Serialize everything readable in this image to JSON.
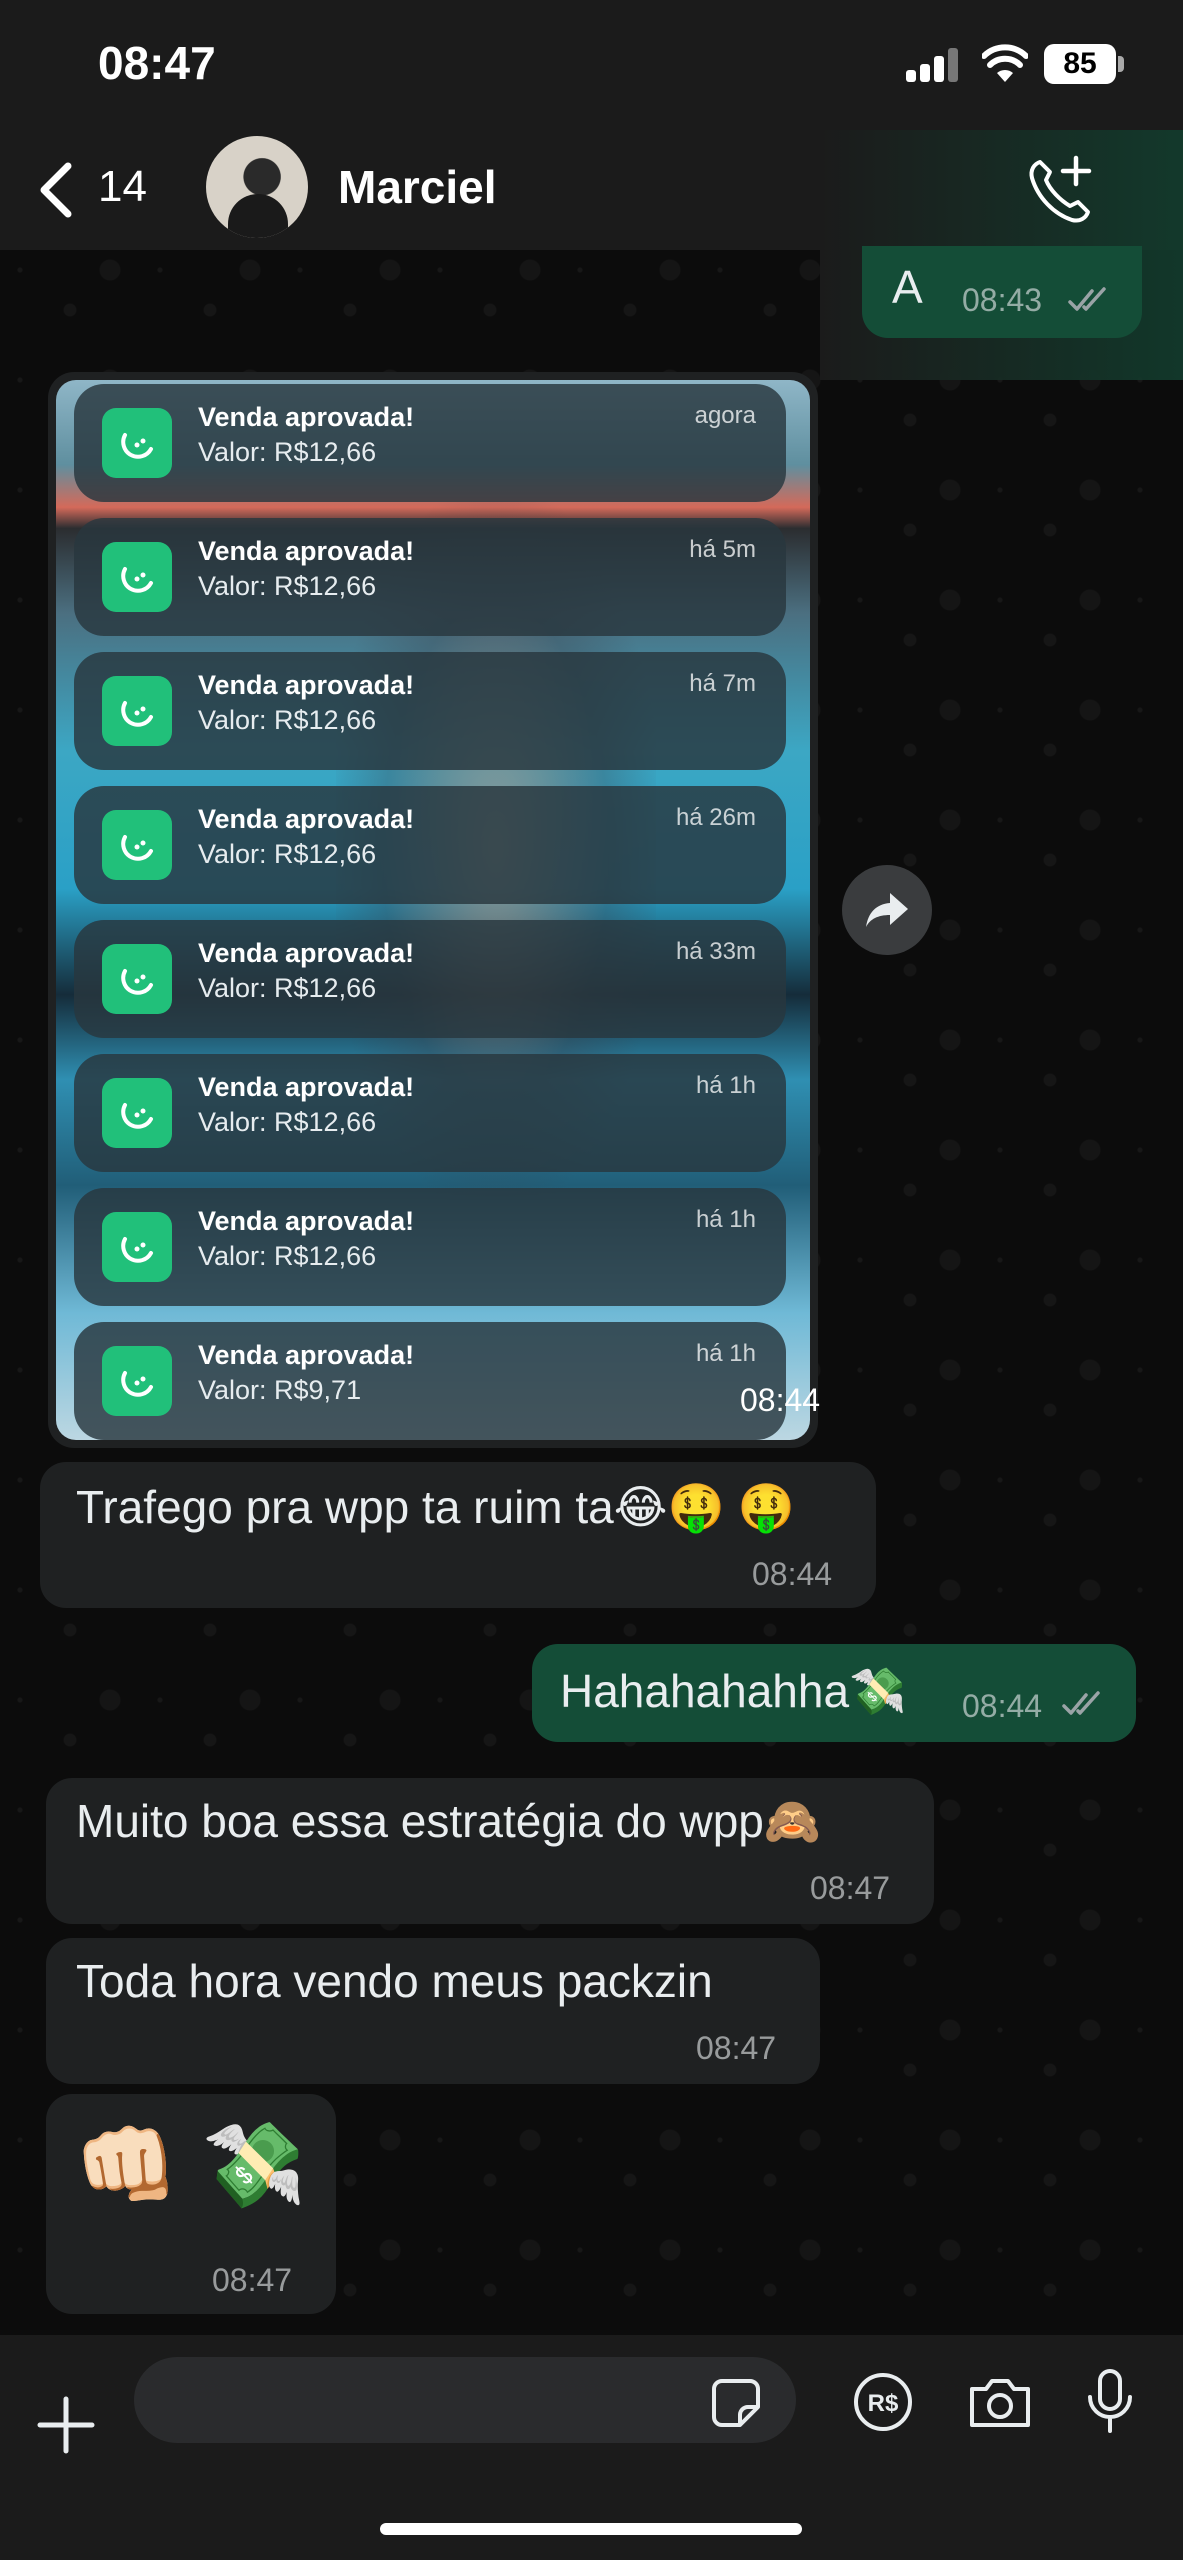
{
  "status_bar": {
    "time": "08:47",
    "battery": "85"
  },
  "header": {
    "back_count": "14",
    "contact_name": "Marciel"
  },
  "messages": {
    "m1": {
      "text": "A",
      "time": "08:43"
    },
    "image": {
      "time": "08:44"
    },
    "m2": {
      "text": "Trafego pra wpp ta ruim ta😂🤑 🤑",
      "time": "08:44"
    },
    "m3": {
      "text": "Hahahahahha💸",
      "time": "08:44"
    },
    "m4": {
      "text": "Muito boa essa estratégia do wpp🙈",
      "time": "08:47"
    },
    "m5": {
      "text": "Toda hora vendo meus packzin",
      "time": "08:47"
    },
    "m6": {
      "text": "👊🏻 💸",
      "time": "08:47"
    }
  },
  "notifications": [
    {
      "title": "Venda aprovada!",
      "value": "Valor: R$12,66",
      "time": "agora"
    },
    {
      "title": "Venda aprovada!",
      "value": "Valor: R$12,66",
      "time": "há 5m"
    },
    {
      "title": "Venda aprovada!",
      "value": "Valor: R$12,66",
      "time": "há 7m"
    },
    {
      "title": "Venda aprovada!",
      "value": "Valor: R$12,66",
      "time": "há 26m"
    },
    {
      "title": "Venda aprovada!",
      "value": "Valor: R$12,66",
      "time": "há 33m"
    },
    {
      "title": "Venda aprovada!",
      "value": "Valor: R$12,66",
      "time": "há 1h"
    },
    {
      "title": "Venda aprovada!",
      "value": "Valor: R$12,66",
      "time": "há 1h"
    },
    {
      "title": "Venda aprovada!",
      "value": "Valor: R$9,71",
      "time": "há 1h"
    }
  ],
  "input": {
    "placeholder": ""
  },
  "colors": {
    "outgoing_bubble": "#144d37",
    "incoming_bubble": "#1f2122",
    "read_ticks": "#9aa3a6",
    "notification_icon": "#21c07a"
  },
  "icons": [
    "back-chevron-icon",
    "add-call-icon",
    "forward-icon",
    "plus-icon",
    "sticker-icon",
    "payment-rs-icon",
    "camera-icon",
    "microphone-icon"
  ]
}
